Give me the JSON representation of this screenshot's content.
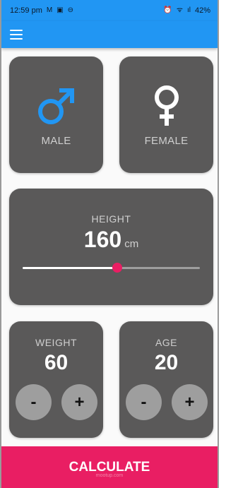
{
  "status_bar": {
    "time": "12:59 pm",
    "left_icons": [
      "M",
      "▣",
      "⊖"
    ],
    "right_icons": [
      "⏰",
      "ᯤ",
      "ıl"
    ],
    "battery": "42%"
  },
  "app_bar": {
    "menu_icon": "hamburger-menu-icon"
  },
  "gender": {
    "male_label": "MALE",
    "female_label": "FEMALE",
    "male_icon_color": "#2196f3",
    "female_icon_color": "#ffffff"
  },
  "height": {
    "label": "HEIGHT",
    "value": "160",
    "unit": "cm",
    "slider_fraction": 0.535
  },
  "weight": {
    "label": "WEIGHT",
    "value": "60",
    "minus": "-",
    "plus": "+"
  },
  "age": {
    "label": "AGE",
    "value": "20",
    "minus": "-",
    "plus": "+"
  },
  "calculate_label": "CALCULATE",
  "watermark": "mootup.com",
  "colors": {
    "primary": "#2196f3",
    "accent": "#e91e63",
    "card": "#5a5959"
  }
}
